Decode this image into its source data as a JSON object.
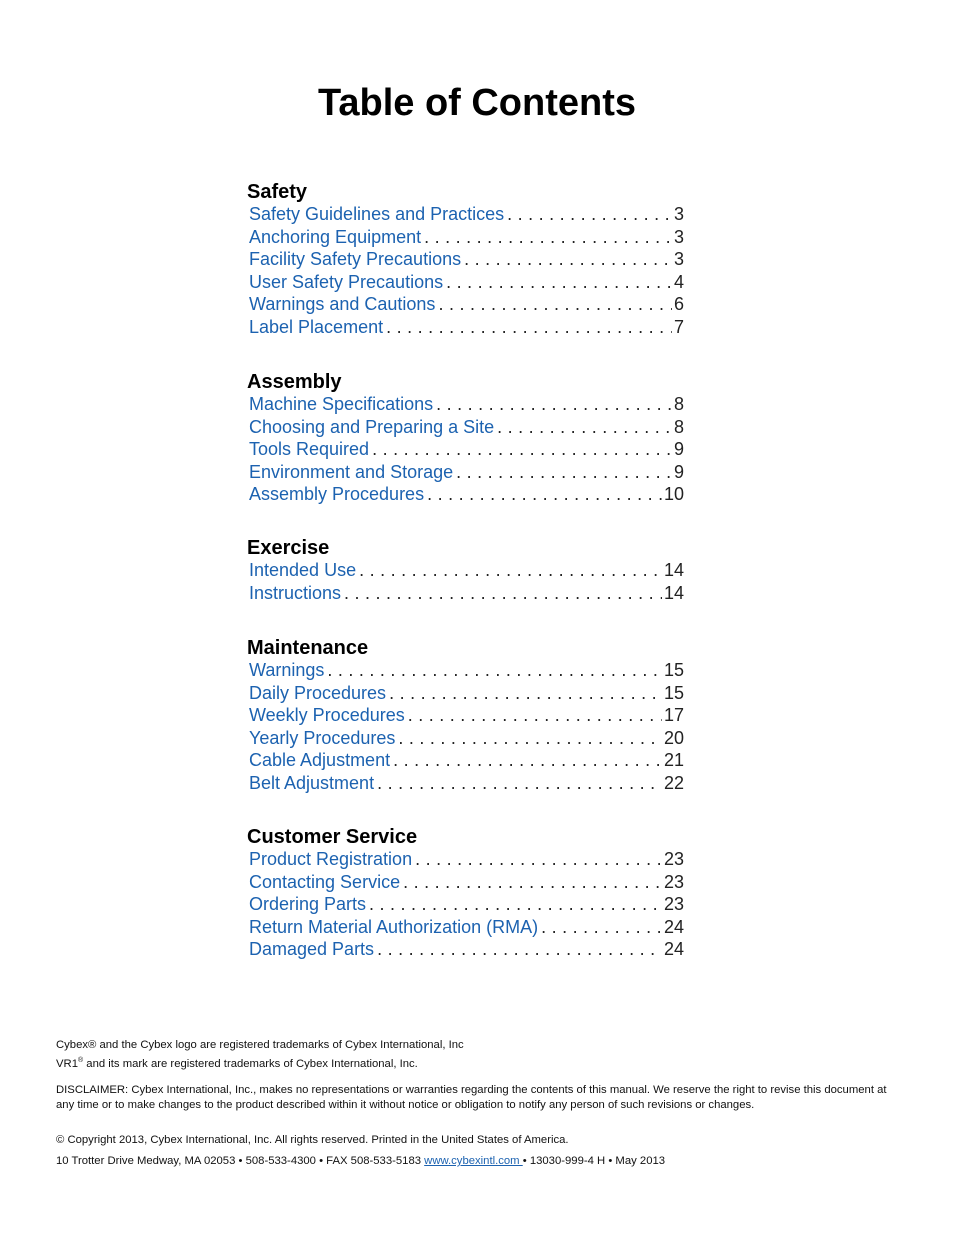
{
  "title": "Table of Contents",
  "sections": [
    {
      "heading": "Safety",
      "entries": [
        {
          "label": "Safety Guidelines and Practices",
          "page": "3"
        },
        {
          "label": "Anchoring Equipment",
          "page": "3"
        },
        {
          "label": "Facility Safety Precautions",
          "page": "3"
        },
        {
          "label": "User Safety Precautions",
          "page": "4"
        },
        {
          "label": "Warnings and Cautions",
          "page": "6"
        },
        {
          "label": "Label Placement",
          "page": "7"
        }
      ]
    },
    {
      "heading": "Assembly",
      "entries": [
        {
          "label": "Machine Specifications",
          "page": "8"
        },
        {
          "label": "Choosing and Preparing a Site",
          "page": "8"
        },
        {
          "label": "Tools Required",
          "page": "9"
        },
        {
          "label": "Environment and Storage",
          "page": "9"
        },
        {
          "label": "Assembly Procedures",
          "page": "10"
        }
      ]
    },
    {
      "heading": "Exercise",
      "entries": [
        {
          "label": "Intended Use",
          "page": "14"
        },
        {
          "label": "Instructions",
          "page": "14"
        }
      ]
    },
    {
      "heading": "Maintenance",
      "entries": [
        {
          "label": "Warnings",
          "page": "15"
        },
        {
          "label": "Daily Procedures",
          "page": "15"
        },
        {
          "label": "Weekly Procedures",
          "page": "17"
        },
        {
          "label": "Yearly Procedures",
          "page": "20"
        },
        {
          "label": "Cable Adjustment",
          "page": "21"
        },
        {
          "label": "Belt Adjustment",
          "page": "22"
        }
      ]
    },
    {
      "heading": "Customer Service",
      "entries": [
        {
          "label": "Product Registration",
          "page": "23"
        },
        {
          "label": "Contacting Service",
          "page": "23"
        },
        {
          "label": "Ordering Parts",
          "page": "23"
        },
        {
          "label": "Return Material Authorization (RMA)",
          "page": "24"
        },
        {
          "label": "Damaged Parts",
          "page": "24"
        }
      ]
    }
  ],
  "footer": {
    "trademark1": "Cybex® and the Cybex logo are registered trademarks of Cybex International, Inc",
    "trademark2_prefix": "VR1",
    "trademark2_sup": "®",
    "trademark2_rest": " and its mark are registered trademarks of Cybex International, Inc.",
    "disclaimer": "DISCLAIMER: Cybex International, Inc., makes no representations or warranties regarding the contents of this manual. We reserve the right to revise this document at any time or to make changes to the product described within it without notice or obligation to notify any person of such revisions or changes.",
    "copyright": "© Copyright 2013, Cybex International, Inc. All rights reserved. Printed in the United States of America.",
    "address": "10 Trotter Drive Medway, MA 02053 • 508-533-4300 • FAX 508-533-5183 ",
    "website": "www.cybexintl.com ",
    "doc_info": " • 13030-999-4 H • May 2013"
  }
}
